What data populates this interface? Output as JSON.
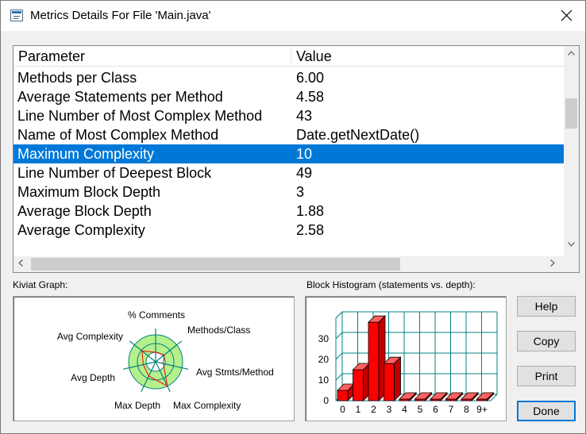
{
  "window": {
    "title": "Metrics Details For File 'Main.java'"
  },
  "table": {
    "columns": [
      "Parameter",
      "Value"
    ],
    "rows": [
      {
        "parameter": "Methods per Class",
        "value": "6.00"
      },
      {
        "parameter": "Average Statements per Method",
        "value": "4.58"
      },
      {
        "parameter": "Line Number of Most Complex Method",
        "value": "43"
      },
      {
        "parameter": "Name of Most Complex Method",
        "value": "Date.getNextDate()"
      },
      {
        "parameter": "Maximum Complexity",
        "value": "10",
        "selected": true
      },
      {
        "parameter": "Line Number of Deepest Block",
        "value": "49"
      },
      {
        "parameter": "Maximum Block Depth",
        "value": "3"
      },
      {
        "parameter": "Average Block Depth",
        "value": "1.88"
      },
      {
        "parameter": "Average Complexity",
        "value": "2.58"
      }
    ]
  },
  "kiviat": {
    "label": "Kiviat Graph:",
    "axes": [
      "% Comments",
      "Methods/Class",
      "Avg Stmts/Method",
      "Max Complexity",
      "Max Depth",
      "Avg Depth",
      "Avg Complexity"
    ]
  },
  "histogram": {
    "label": "Block Histogram (statements vs. depth):",
    "chart_data": {
      "type": "bar",
      "categories": [
        "0",
        "1",
        "2",
        "3",
        "4",
        "5",
        "6",
        "7",
        "8",
        "9+"
      ],
      "values": [
        5,
        15,
        38,
        18,
        0,
        0,
        0,
        0,
        0,
        0
      ],
      "y_ticks": [
        "0",
        "10",
        "20",
        "30"
      ],
      "ylim": [
        0,
        40
      ],
      "bar_color": "#ff0000",
      "grid_color": "#008080"
    }
  },
  "buttons": {
    "help": "Help",
    "copy": "Copy",
    "print": "Print",
    "done": "Done"
  },
  "colors": {
    "selection": "#0078d7",
    "kiviat_ring": "#b4f08c",
    "kiviat_grid": "#008080",
    "kiviat_line": "#ff0000"
  }
}
